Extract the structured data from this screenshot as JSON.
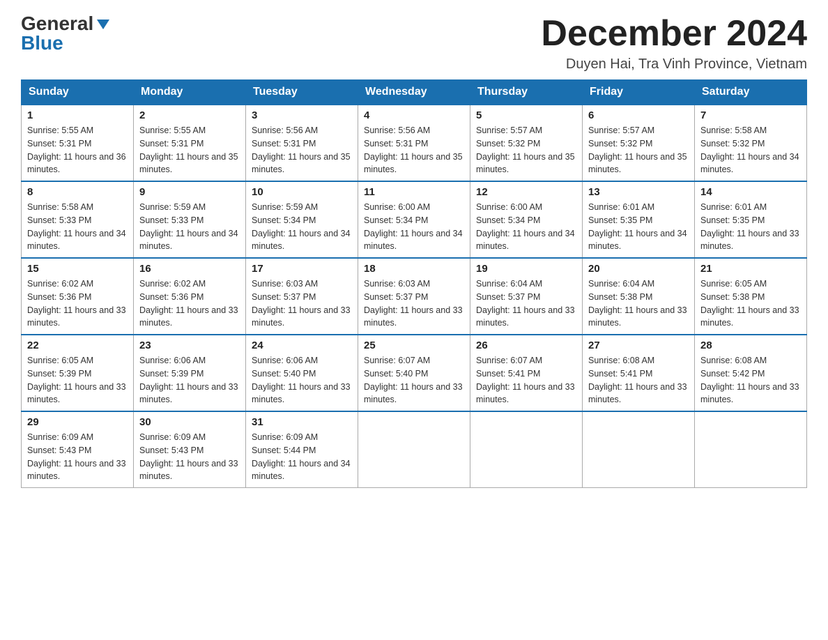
{
  "logo": {
    "general": "General",
    "blue": "Blue"
  },
  "header": {
    "title": "December 2024",
    "location": "Duyen Hai, Tra Vinh Province, Vietnam"
  },
  "weekdays": [
    "Sunday",
    "Monday",
    "Tuesday",
    "Wednesday",
    "Thursday",
    "Friday",
    "Saturday"
  ],
  "weeks": [
    [
      {
        "day": "1",
        "sunrise": "5:55 AM",
        "sunset": "5:31 PM",
        "daylight": "11 hours and 36 minutes."
      },
      {
        "day": "2",
        "sunrise": "5:55 AM",
        "sunset": "5:31 PM",
        "daylight": "11 hours and 35 minutes."
      },
      {
        "day": "3",
        "sunrise": "5:56 AM",
        "sunset": "5:31 PM",
        "daylight": "11 hours and 35 minutes."
      },
      {
        "day": "4",
        "sunrise": "5:56 AM",
        "sunset": "5:31 PM",
        "daylight": "11 hours and 35 minutes."
      },
      {
        "day": "5",
        "sunrise": "5:57 AM",
        "sunset": "5:32 PM",
        "daylight": "11 hours and 35 minutes."
      },
      {
        "day": "6",
        "sunrise": "5:57 AM",
        "sunset": "5:32 PM",
        "daylight": "11 hours and 35 minutes."
      },
      {
        "day": "7",
        "sunrise": "5:58 AM",
        "sunset": "5:32 PM",
        "daylight": "11 hours and 34 minutes."
      }
    ],
    [
      {
        "day": "8",
        "sunrise": "5:58 AM",
        "sunset": "5:33 PM",
        "daylight": "11 hours and 34 minutes."
      },
      {
        "day": "9",
        "sunrise": "5:59 AM",
        "sunset": "5:33 PM",
        "daylight": "11 hours and 34 minutes."
      },
      {
        "day": "10",
        "sunrise": "5:59 AM",
        "sunset": "5:34 PM",
        "daylight": "11 hours and 34 minutes."
      },
      {
        "day": "11",
        "sunrise": "6:00 AM",
        "sunset": "5:34 PM",
        "daylight": "11 hours and 34 minutes."
      },
      {
        "day": "12",
        "sunrise": "6:00 AM",
        "sunset": "5:34 PM",
        "daylight": "11 hours and 34 minutes."
      },
      {
        "day": "13",
        "sunrise": "6:01 AM",
        "sunset": "5:35 PM",
        "daylight": "11 hours and 34 minutes."
      },
      {
        "day": "14",
        "sunrise": "6:01 AM",
        "sunset": "5:35 PM",
        "daylight": "11 hours and 33 minutes."
      }
    ],
    [
      {
        "day": "15",
        "sunrise": "6:02 AM",
        "sunset": "5:36 PM",
        "daylight": "11 hours and 33 minutes."
      },
      {
        "day": "16",
        "sunrise": "6:02 AM",
        "sunset": "5:36 PM",
        "daylight": "11 hours and 33 minutes."
      },
      {
        "day": "17",
        "sunrise": "6:03 AM",
        "sunset": "5:37 PM",
        "daylight": "11 hours and 33 minutes."
      },
      {
        "day": "18",
        "sunrise": "6:03 AM",
        "sunset": "5:37 PM",
        "daylight": "11 hours and 33 minutes."
      },
      {
        "day": "19",
        "sunrise": "6:04 AM",
        "sunset": "5:37 PM",
        "daylight": "11 hours and 33 minutes."
      },
      {
        "day": "20",
        "sunrise": "6:04 AM",
        "sunset": "5:38 PM",
        "daylight": "11 hours and 33 minutes."
      },
      {
        "day": "21",
        "sunrise": "6:05 AM",
        "sunset": "5:38 PM",
        "daylight": "11 hours and 33 minutes."
      }
    ],
    [
      {
        "day": "22",
        "sunrise": "6:05 AM",
        "sunset": "5:39 PM",
        "daylight": "11 hours and 33 minutes."
      },
      {
        "day": "23",
        "sunrise": "6:06 AM",
        "sunset": "5:39 PM",
        "daylight": "11 hours and 33 minutes."
      },
      {
        "day": "24",
        "sunrise": "6:06 AM",
        "sunset": "5:40 PM",
        "daylight": "11 hours and 33 minutes."
      },
      {
        "day": "25",
        "sunrise": "6:07 AM",
        "sunset": "5:40 PM",
        "daylight": "11 hours and 33 minutes."
      },
      {
        "day": "26",
        "sunrise": "6:07 AM",
        "sunset": "5:41 PM",
        "daylight": "11 hours and 33 minutes."
      },
      {
        "day": "27",
        "sunrise": "6:08 AM",
        "sunset": "5:41 PM",
        "daylight": "11 hours and 33 minutes."
      },
      {
        "day": "28",
        "sunrise": "6:08 AM",
        "sunset": "5:42 PM",
        "daylight": "11 hours and 33 minutes."
      }
    ],
    [
      {
        "day": "29",
        "sunrise": "6:09 AM",
        "sunset": "5:43 PM",
        "daylight": "11 hours and 33 minutes."
      },
      {
        "day": "30",
        "sunrise": "6:09 AM",
        "sunset": "5:43 PM",
        "daylight": "11 hours and 33 minutes."
      },
      {
        "day": "31",
        "sunrise": "6:09 AM",
        "sunset": "5:44 PM",
        "daylight": "11 hours and 34 minutes."
      },
      null,
      null,
      null,
      null
    ]
  ]
}
